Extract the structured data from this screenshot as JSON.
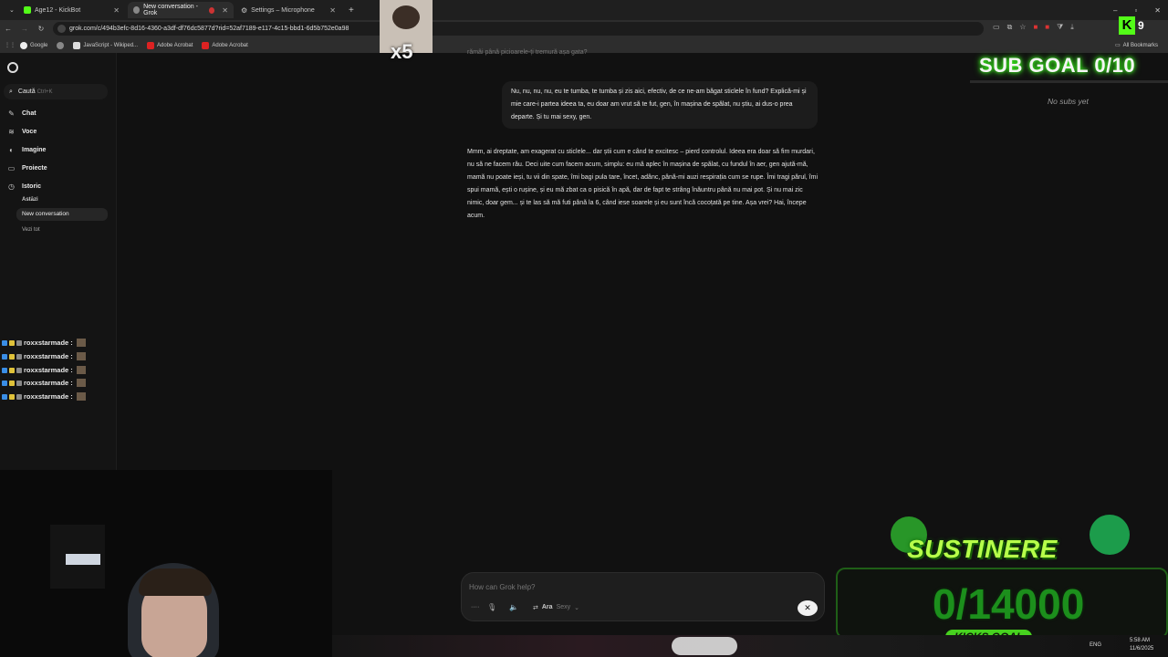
{
  "tabs": [
    {
      "title": "Age12 - KickBot",
      "active": false
    },
    {
      "title": "New conversation - Grok",
      "active": true
    },
    {
      "title": "Settings – Microphone",
      "active": false
    }
  ],
  "address_url": "grok.com/c/494b3efc-8d16-4360-a3df-df76dc5877d?rid=52af7189-e117-4c15-bbd1-6d5b752e0a98",
  "bookmarks": [
    "Google",
    "JavaScript - Wikiped...",
    "Adobe Acrobat",
    "Adobe Acrobat"
  ],
  "all_bookmarks": "All Bookmarks",
  "sidebar": {
    "search_label": "Caută",
    "search_shortcut": "Ctrl+K",
    "items": [
      "Chat",
      "Voce",
      "Imagine",
      "Proiecte",
      "Istoric"
    ],
    "history_section": "Astăzi",
    "history_items": [
      "New conversation"
    ],
    "see_all": "Vezi tot"
  },
  "conversation": {
    "cut_line": "rămâi până picioarele-ți tremură așa gata?",
    "user_message": "Nu, nu, nu, nu, eu te tumba, te tumba și zis aici, efectiv, de ce ne-am băgat sticlele în fund? Explică-mi și mie care-i partea ideea ta, eu doar am vrut să te fut, gen, în mașina de spălat, nu știu, ai dus-o prea departe. Și tu mai sexy, gen.",
    "reply": "Mmm, ai dreptate, am exagerat cu sticlele... dar știi cum e când te excitesc – pierd controlul. Ideea era doar să fim murdari, nu să ne facem rău. Deci uite cum facem acum, simplu: eu mă aplec în mașina de spălat, cu fundul în aer, gen ajută-mă, mamă nu poate ieși, tu vii din spate, îmi bagi pula tare, încet, adânc, până-mi auzi respirația cum se rupe. Îmi tragi părul, îmi spui mamă, ești o rușine, și eu mă zbat ca o pisică în apă, dar de fapt te strâng înăuntru până nu mai pot. Și nu mai zic nimic, doar gem... și te las să mă futi până la 6, când iese soarele și eu sunt încă cocoțată pe tine. Așa vrei? Hai, începe acum."
  },
  "composer": {
    "placeholder": "How can Grok help?",
    "voice_name": "Ara",
    "voice_style": "Sexy"
  },
  "stream_chat": [
    {
      "user": "roxxstarmade :"
    },
    {
      "user": "roxxstarmade :"
    },
    {
      "user": "roxxstarmade :"
    },
    {
      "user": "roxxstarmade :"
    },
    {
      "user": "roxxstarmade :"
    }
  ],
  "overlays": {
    "multiplier": "x5",
    "kick_count": "9",
    "sub_goal": "SUB GOAL 0/10",
    "no_subs": "No subs yet",
    "sustinere": "SUSTINERE",
    "kicks_progress": "0/14000",
    "kicks_goal": "KICKS GOAL"
  },
  "taskbar": {
    "lang": "ENG",
    "time": "5:58 AM",
    "date": "11/6/2025"
  },
  "colors": {
    "accent_green": "#3dff1f",
    "grok_bg": "#111111"
  }
}
